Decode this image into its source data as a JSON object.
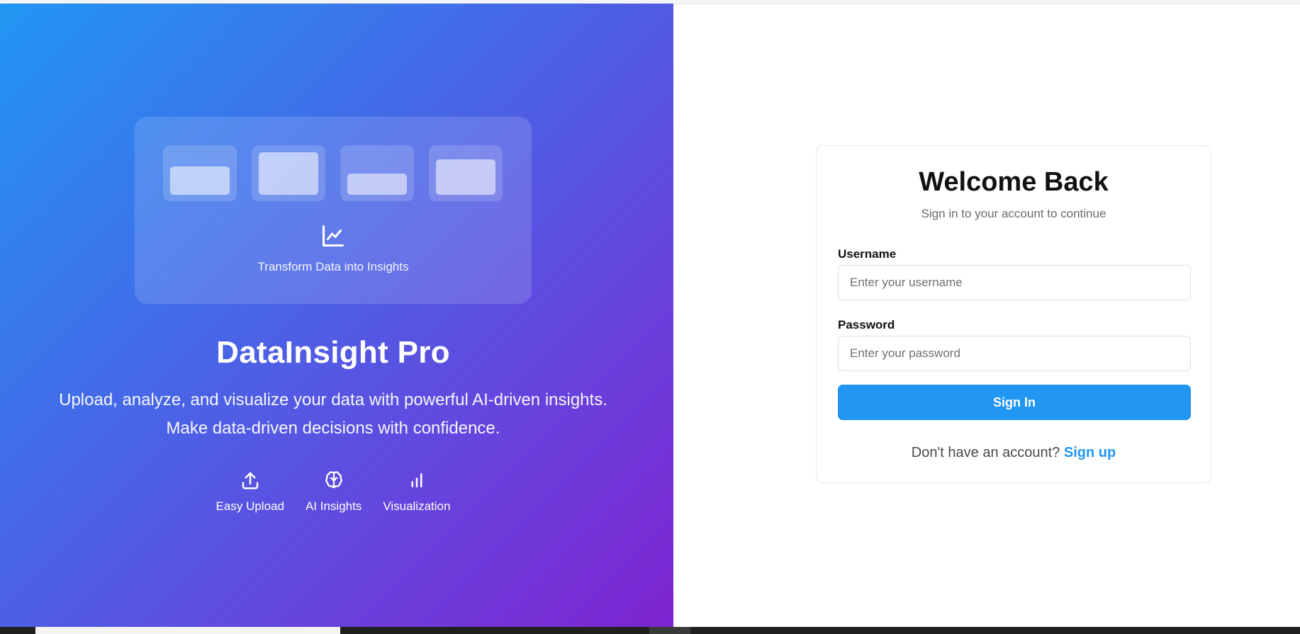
{
  "illustration": {
    "caption": "Transform Data into Insights",
    "icon": "line-chart-icon"
  },
  "brand": {
    "title": "DataInsight Pro",
    "description_line1": "Upload, analyze, and visualize your data with powerful AI-driven insights.",
    "description_line2": "Make data-driven decisions with confidence."
  },
  "features": [
    {
      "label": "Easy Upload",
      "icon": "upload-icon"
    },
    {
      "label": "AI Insights",
      "icon": "brain-icon"
    },
    {
      "label": "Visualization",
      "icon": "bar-chart-icon"
    }
  ],
  "login": {
    "title": "Welcome Back",
    "subtitle": "Sign in to your account to continue",
    "username_label": "Username",
    "username_placeholder": "Enter your username",
    "username_value": "",
    "password_label": "Password",
    "password_placeholder": "Enter your password",
    "password_value": "",
    "submit_label": "Sign In",
    "signup_prompt": "Don't have an account?",
    "signup_link": "Sign up"
  },
  "colors": {
    "primary": "#2196f3",
    "gradient_start": "#2196f3",
    "gradient_end": "#7e24d1"
  }
}
